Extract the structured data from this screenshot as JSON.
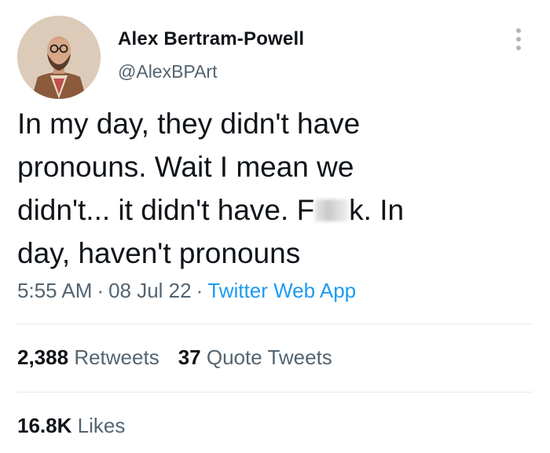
{
  "author": {
    "display_name": "Alex Bertram-Powell",
    "handle": "@AlexBPArt",
    "avatar_icon": "illustrated-bearded-man-avatar"
  },
  "tweet": {
    "lines": [
      "In my day, they didn't have",
      "pronouns. Wait I mean we",
      "didn't... it didn't have. F",
      "k. In",
      "day, haven't pronouns"
    ]
  },
  "meta": {
    "time": "5:55 AM",
    "separator": "·",
    "date": "08 Jul 22",
    "source": "Twitter Web App"
  },
  "stats": {
    "retweets_count": "2,388",
    "retweets_label": "Retweets",
    "quotes_count": "37",
    "quotes_label": "Quote Tweets",
    "likes_count": "16.8K",
    "likes_label": "Likes"
  },
  "colors": {
    "text": "#0f1419",
    "secondary": "#536471",
    "link": "#1d9bf0",
    "divider": "#e5e8eb"
  }
}
